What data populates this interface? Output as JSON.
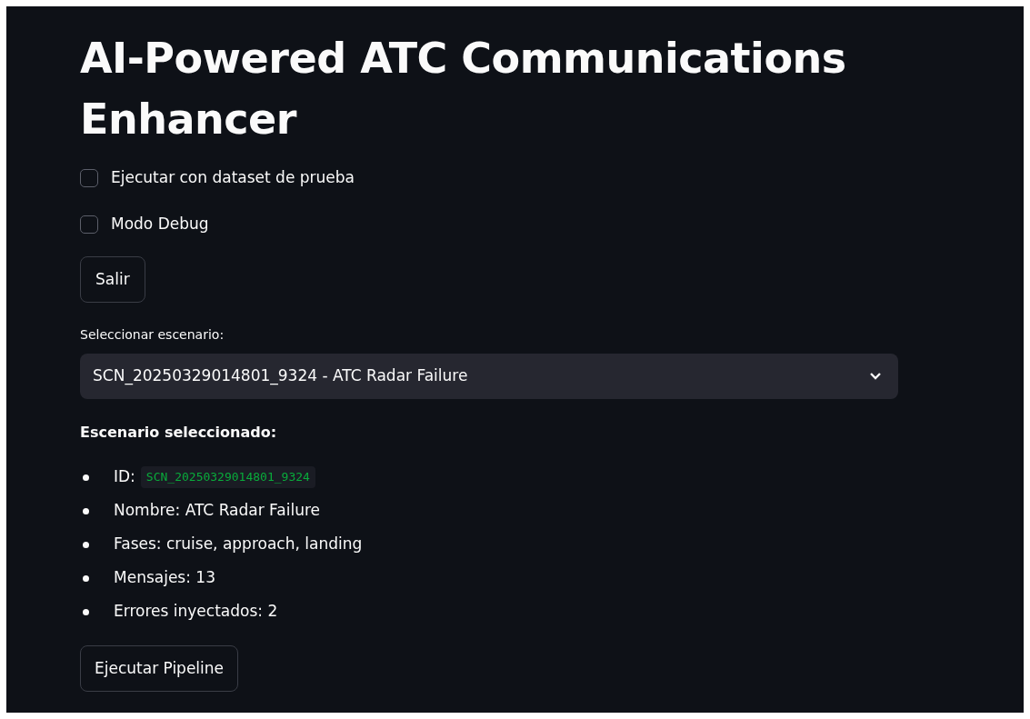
{
  "title": "AI-Powered ATC Communications Enhancer",
  "checkboxes": [
    {
      "label": "Ejecutar con dataset de prueba",
      "checked": false
    },
    {
      "label": "Modo Debug",
      "checked": false
    }
  ],
  "exit_button": "Salir",
  "select": {
    "label": "Seleccionar escenario:",
    "value": "SCN_20250329014801_9324 - ATC Radar Failure"
  },
  "details": {
    "heading": "Escenario seleccionado:",
    "items": [
      {
        "kind": "code",
        "label": "ID:",
        "code": "SCN_20250329014801_9324"
      },
      {
        "kind": "text",
        "label": "Nombre: ATC Radar Failure"
      },
      {
        "kind": "text",
        "label": "Fases: cruise, approach, landing"
      },
      {
        "kind": "text",
        "label": "Mensajes: 13"
      },
      {
        "kind": "text",
        "label": "Errores inyectados: 2"
      }
    ]
  },
  "run_button": "Ejecutar Pipeline"
}
